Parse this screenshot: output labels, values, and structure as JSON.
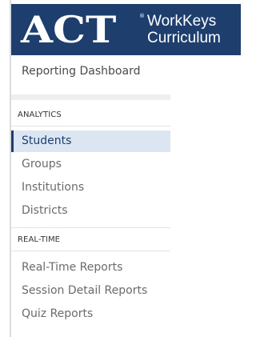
{
  "logo": {
    "brand": "ACT",
    "trademark": "®",
    "product_line1": "WorkKeys",
    "product_line2": "Curriculum"
  },
  "dashboard_title": "Reporting Dashboard",
  "sections": [
    {
      "heading": "ANALYTICS",
      "items": [
        {
          "label": "Students",
          "active": true
        },
        {
          "label": "Groups",
          "active": false
        },
        {
          "label": "Institutions",
          "active": false
        },
        {
          "label": "Districts",
          "active": false
        }
      ]
    },
    {
      "heading": "REAL-TIME",
      "items": [
        {
          "label": "Real-Time Reports",
          "active": false
        },
        {
          "label": "Session Detail Reports",
          "active": false
        },
        {
          "label": "Quiz Reports",
          "active": false
        }
      ]
    }
  ],
  "colors": {
    "brand_navy": "#1e3f6e",
    "active_bg": "#dce6f2",
    "text": "#6b6b6b"
  }
}
